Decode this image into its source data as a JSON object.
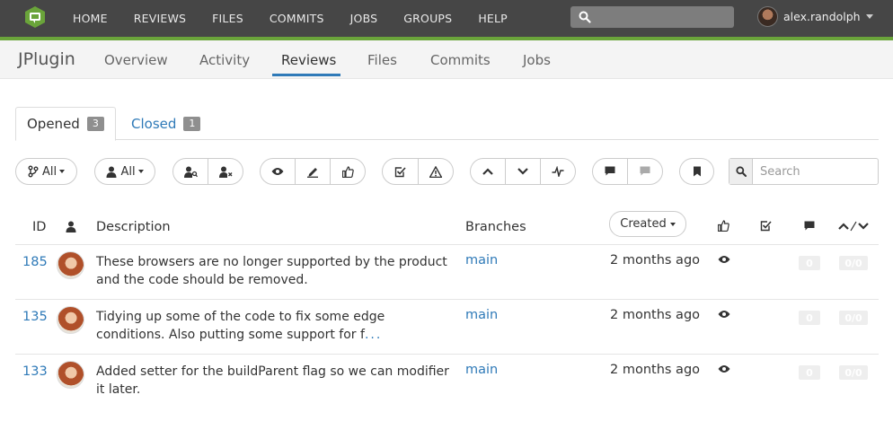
{
  "topnav": {
    "items": [
      "HOME",
      "REVIEWS",
      "FILES",
      "COMMITS",
      "JOBS",
      "GROUPS",
      "HELP"
    ],
    "search_placeholder": "",
    "user_name": "alex.randolph"
  },
  "subnav": {
    "project": "JPlugin",
    "tabs": [
      "Overview",
      "Activity",
      "Reviews",
      "Files",
      "Commits",
      "Jobs"
    ],
    "active_tab": "Reviews"
  },
  "review_tabs": {
    "opened": {
      "label": "Opened",
      "count": "3"
    },
    "closed": {
      "label": "Closed",
      "count": "1"
    }
  },
  "filters": {
    "project_filter": "All",
    "author_filter": "All",
    "search_placeholder": "Search"
  },
  "table": {
    "headers": {
      "id": "ID",
      "description": "Description",
      "branches": "Branches",
      "created": "Created"
    },
    "rows": [
      {
        "id": "185",
        "desc": "These browsers are no longer supported by the product and the code should be removed.",
        "more": "",
        "branch": "main",
        "created": "2 months ago",
        "comments": "0",
        "votes": "0/0"
      },
      {
        "id": "135",
        "desc": "Tidying up some of the code to fix some edge conditions. Also putting some support for f",
        "more": "...",
        "branch": "main",
        "created": "2 months ago",
        "comments": "0",
        "votes": "0/0"
      },
      {
        "id": "133",
        "desc": "Added setter for the buildParent flag so we can modifier it later.",
        "more": "",
        "branch": "main",
        "created": "2 months ago",
        "comments": "0",
        "votes": "0/0"
      }
    ]
  },
  "colors": {
    "accent": "#2f7ab8",
    "topbar": "#464646",
    "brand_stripe": "#6aa43a"
  }
}
